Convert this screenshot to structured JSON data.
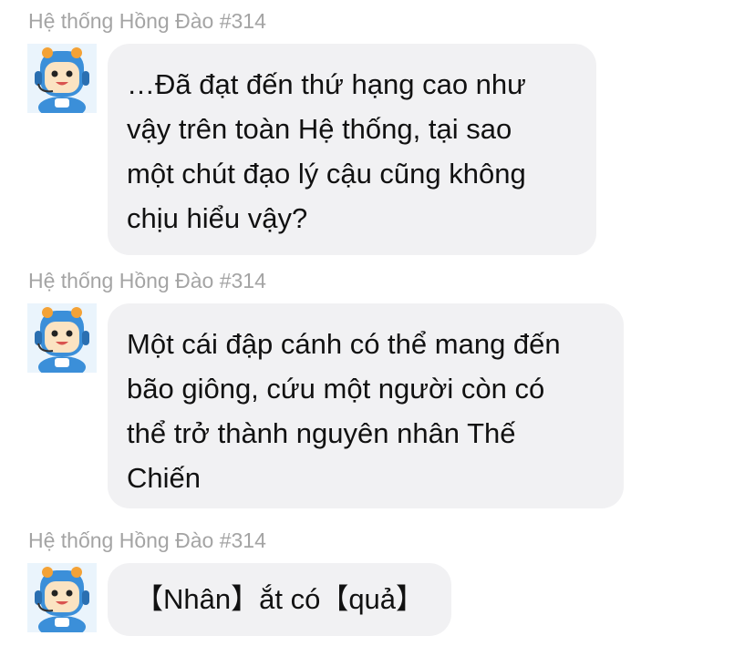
{
  "messages": [
    {
      "sender": "Hệ thống Hồng Đào #314",
      "avatar_icon": "mascot-headset-avatar-icon",
      "text": "…Đã đạt đến thứ hạng cao như\nvậy trên toàn Hệ thống, tại sao\nmột chút đạo lý cậu cũng không\nchịu hiểu vậy?"
    },
    {
      "sender": "Hệ thống Hồng Đào #314",
      "avatar_icon": "mascot-headset-avatar-icon",
      "text": "Một cái đập cánh có thể mang đến\nbão giông, cứu một người còn có\nthể trở thành nguyên nhân Thế\nChiến"
    },
    {
      "sender": "Hệ thống Hồng Đào #314",
      "avatar_icon": "mascot-headset-avatar-icon",
      "text": "【Nhân】ắt có【quả】"
    }
  ],
  "colors": {
    "bubble_background": "#f1f1f3",
    "sender_name": "#a4a4a4",
    "message_text": "#111111",
    "avatar_blue": "#3b8fd9",
    "avatar_orange": "#f4a236",
    "avatar_skin": "#fbe3c2"
  }
}
